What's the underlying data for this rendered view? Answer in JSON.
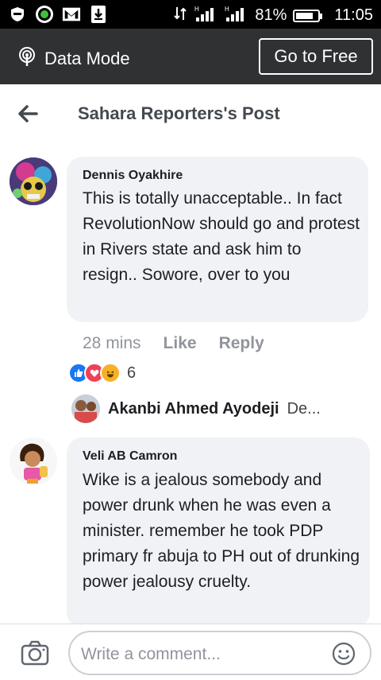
{
  "statusbar": {
    "battery_percent": "81%",
    "battery_level": 0.81,
    "time": "11:05",
    "network_labels": [
      "1L",
      "H",
      "H"
    ]
  },
  "data_mode_bar": {
    "label": "Data Mode",
    "go_free_label": "Go to Free"
  },
  "header": {
    "title": "Sahara Reporters's Post"
  },
  "comments": [
    {
      "author": "Dennis Oyakhire",
      "text": "This is totally unacceptable.. In fact RevolutionNow should go and protest in Rivers state and ask him to resign.. Sowore, over to you",
      "time": "28 mins",
      "like_label": "Like",
      "reply_label": "Reply",
      "reaction_count": "6",
      "reactions": [
        "like",
        "love",
        "haha"
      ],
      "reply_preview": {
        "author": "Akanbi Ahmed Ayodeji",
        "snippet": "De..."
      }
    },
    {
      "author": "Veli AB Camron",
      "text": "Wike is a jealous somebody and power drunk when he was even a minister. remember he took PDP primary fr abuja to PH out of drunking power jealousy cruelty."
    }
  ],
  "composer": {
    "placeholder": "Write a comment..."
  },
  "colors": {
    "status_bg": "#000000",
    "data_bar_bg": "#2f3133",
    "bubble_bg": "#f0f2f5",
    "meta_text": "#90949c",
    "like_blue": "#1877f2",
    "love_red": "#f33e58",
    "haha_yellow": "#f7b125"
  }
}
